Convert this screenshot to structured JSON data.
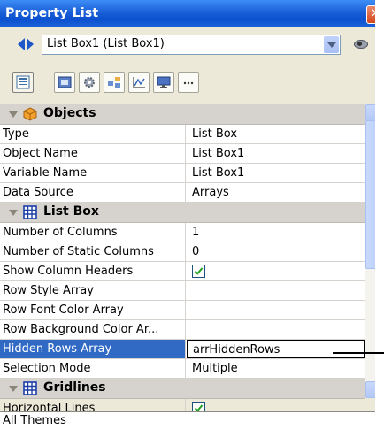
{
  "window": {
    "title": "Property List"
  },
  "selector": {
    "value": "List Box1 (List Box1)"
  },
  "sections": [
    {
      "title": "Objects",
      "rows": [
        {
          "name": "Type",
          "value": "List Box"
        },
        {
          "name": "Object Name",
          "value": "List Box1"
        },
        {
          "name": "Variable Name",
          "value": "List Box1"
        },
        {
          "name": "Data Source",
          "value": "Arrays"
        }
      ]
    },
    {
      "title": "List Box",
      "rows": [
        {
          "name": "Number of Columns",
          "value": "1"
        },
        {
          "name": "Number of Static Columns",
          "value": "0"
        },
        {
          "name": "Show Column Headers",
          "value": "",
          "checked": true
        },
        {
          "name": "Row Style Array",
          "value": ""
        },
        {
          "name": "Row Font Color Array",
          "value": ""
        },
        {
          "name": "Row Background Color Ar...",
          "value": ""
        },
        {
          "name": "Hidden Rows Array",
          "value": "arrHiddenRows",
          "selected": true
        },
        {
          "name": "Selection Mode",
          "value": "Multiple"
        }
      ]
    },
    {
      "title": "Gridlines",
      "rows": [
        {
          "name": "Horizontal Lines",
          "value": "",
          "checked": true
        }
      ]
    }
  ],
  "footer": {
    "theme_label": "All Themes"
  },
  "icons": {
    "nav": "left-right-arrows-icon",
    "eye": "eye-icon",
    "tabs": [
      "properties-list-icon",
      "appearance-icon",
      "settings-gear-icon",
      "objects-icon",
      "chart-icon",
      "display-icon",
      "more-icon"
    ]
  }
}
